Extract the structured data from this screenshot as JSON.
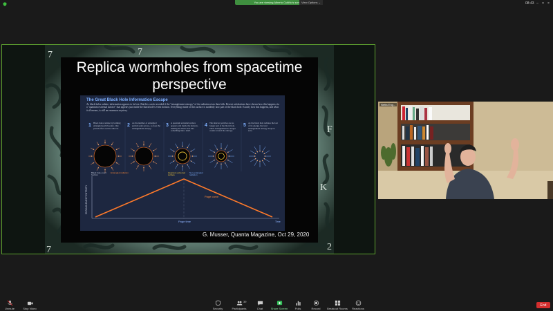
{
  "topbar": {
    "banner_text": "You are viewing Alberto Cuitiño's screen",
    "view_options": "View Options ⌄",
    "clock": "08:43"
  },
  "slide": {
    "title": "Replica wormholes from spacetime perspective",
    "panel_title": "The Great Black Hole Information Escape",
    "panel_intro": "As black holes radiate, information appears to be lost. But this can be avoided if the \"entanglement entropy\" of the radiation rises then falls. Recent calculations have shown how this happens via a \"quantum extremal surface\" that appears just inside the black hole's event horizon. Everything inside of this surface is suddenly now part of the black hole. Exactly how this happens, and what it all means, is still an enormous mystery.",
    "steps": [
      {
        "num": "1",
        "text": "Black holes radiate by forming entangled particle pairs. One particle flies out the other in."
      },
      {
        "num": "2",
        "text": "As the number of entangled particle pairs grows, so does the entanglement entropy."
      },
      {
        "num": "3",
        "text": "A quantum extremal surface appears and inside the horizon, making the black hole into something like a shell."
      },
      {
        "num": "4",
        "text": "The interior particles are no longer part of the black hole. Their entanglement no longer counts toward the entropy."
      },
      {
        "num": "5",
        "text": "As the black hole radiates the last of its energy, the total entanglement entropy drops to zero."
      }
    ],
    "labels": {
      "bh_horizon": "Black hole event horizon",
      "entangled": "Entangled radiation",
      "qes": "Quantum extremal surface",
      "non_entangled": "Non-entangled radiation",
      "yaxis": "ENTANGLEMENT ENTROPY",
      "page_curve": "Page curve",
      "page_time": "Page time",
      "time": "Time"
    },
    "caption": "G. Musser, Quanta Magazine, Oct 29, 2020"
  },
  "video": {
    "name": "Netta Eng..."
  },
  "toolbar": {
    "items": [
      {
        "label": "Unmute",
        "icon": "mic-muted-icon"
      },
      {
        "label": "Stop Video",
        "icon": "camera-icon"
      },
      {
        "label": "Security",
        "icon": "shield-icon"
      },
      {
        "label": "Participants",
        "icon": "people-icon",
        "count": "39"
      },
      {
        "label": "Chat",
        "icon": "chat-icon"
      },
      {
        "label": "Share Screen",
        "icon": "share-screen-icon"
      },
      {
        "label": "Polls",
        "icon": "polls-icon"
      },
      {
        "label": "Record",
        "icon": "record-icon"
      },
      {
        "label": "Breakout Rooms",
        "icon": "breakout-rooms-icon"
      },
      {
        "label": "Reactions",
        "icon": "reactions-icon"
      }
    ],
    "end_label": "End"
  },
  "colors": {
    "share_border": "#5fa32f",
    "banner": "#3f8f3f",
    "end": "#d32e2e",
    "curve": "#ff7a2a"
  }
}
